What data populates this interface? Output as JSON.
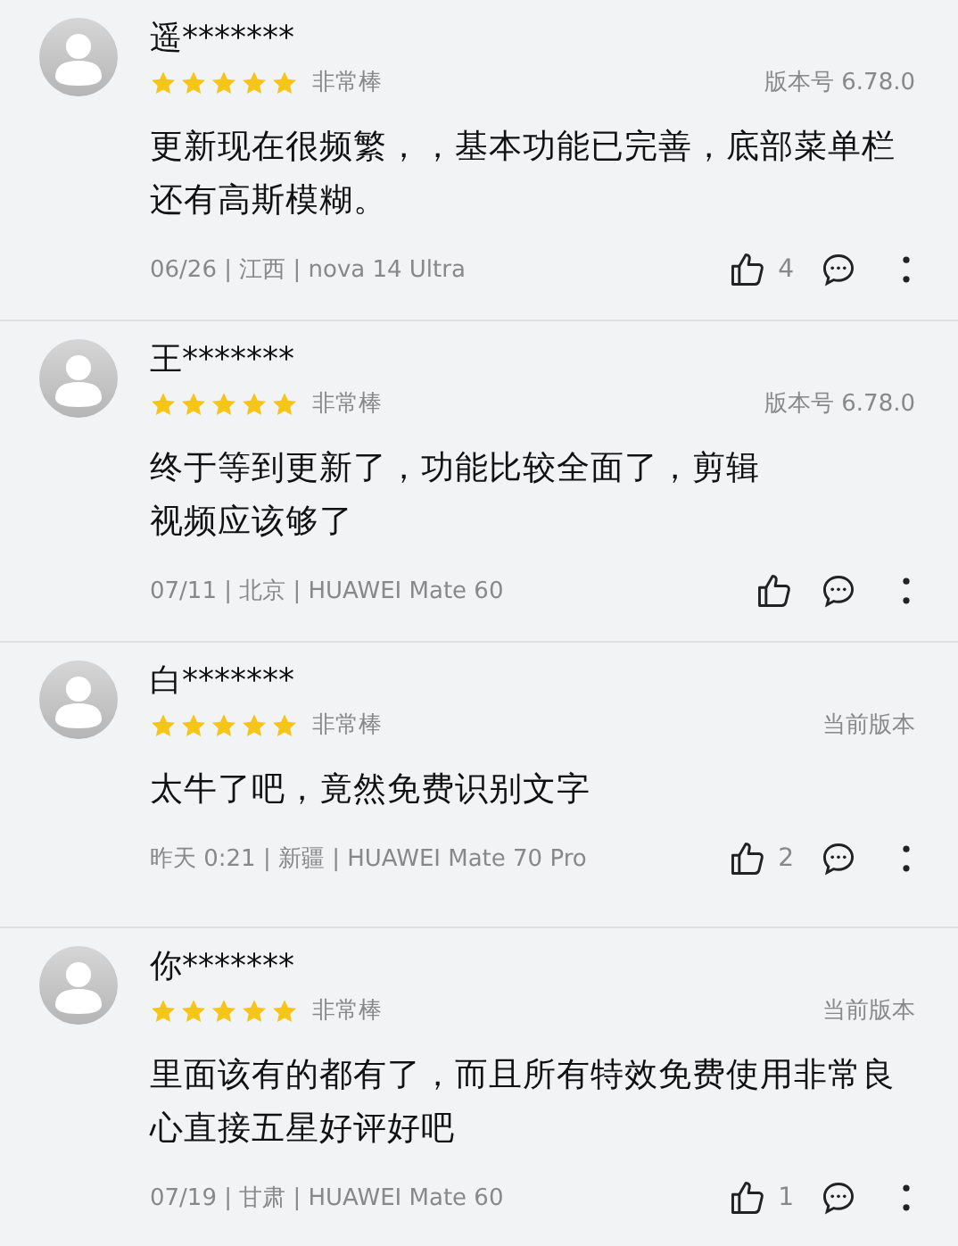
{
  "reviews": [
    {
      "name": "遥*******",
      "stars": 5,
      "rating_label": "非常棒",
      "version": "版本号 6.78.0",
      "text_lines": [
        "更新现在很频繁，，基本功能已完善，底部菜单栏",
        "还有高斯模糊。"
      ],
      "meta": "06/26 | 江西 | nova 14 Ultra",
      "likes": "4"
    },
    {
      "name": "王*******",
      "stars": 5,
      "rating_label": "非常棒",
      "version": "版本号 6.78.0",
      "text_lines": [
        "终于等到更新了，功能比较全面了，剪辑",
        "视频应该够了"
      ],
      "meta": "07/11 | 北京 | HUAWEI Mate 60"
    },
    {
      "name": "白*******",
      "stars": 5,
      "rating_label": "非常棒",
      "version": "当前版本",
      "text_lines": [
        "太牛了吧，竟然免费识别文字"
      ],
      "meta": "昨天 0:21 | 新疆 | HUAWEI Mate 70 Pro",
      "likes": "2"
    },
    {
      "name": "你*******",
      "stars": 5,
      "rating_label": "非常棒",
      "version": "当前版本",
      "text_lines": [
        "里面该有的都有了，而且所有特效免费使用非常良",
        "心直接五星好评好吧"
      ],
      "meta": "07/19 | 甘肃 | HUAWEI Mate 60",
      "likes": "1"
    }
  ]
}
